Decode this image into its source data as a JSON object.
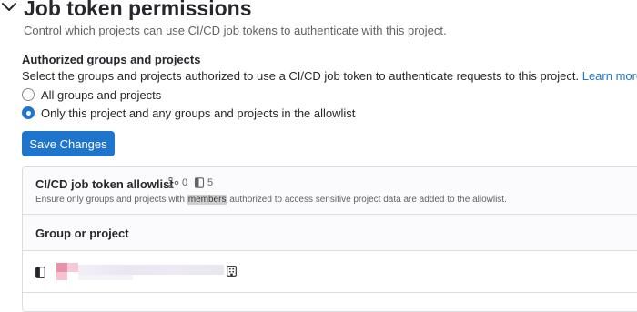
{
  "section": {
    "title": "Job token permissions",
    "description": "Control which projects can use CI/CD job tokens to authenticate with this project."
  },
  "authorized": {
    "label": "Authorized groups and projects",
    "help_text": "Select the groups and projects authorized to use a CI/CD job token to authenticate requests to this project.",
    "learn_more": "Learn more.",
    "options": [
      {
        "label": "All groups and projects",
        "checked": false
      },
      {
        "label": "Only this project and any groups and projects in the allowlist",
        "checked": true
      }
    ]
  },
  "save_button": "Save Changes",
  "allowlist": {
    "title": "CI/CD job token allowlist",
    "group_count": "0",
    "project_count": "5",
    "description_before": "Ensure only groups and projects with",
    "description_highlight": "members",
    "description_after": "authorized to access sensitive project data are added to the allowlist.",
    "column_header": "Group or project"
  },
  "colors": {
    "accent": "#1f75cb",
    "text": "#28272d",
    "muted": "#626168",
    "border": "#dcdcde"
  },
  "icons": {
    "section_toggle": "chevron-down-icon",
    "group_count": "group-icon",
    "project_count": "project-icon",
    "row_type": "project-icon",
    "row_action": "organization-icon"
  }
}
